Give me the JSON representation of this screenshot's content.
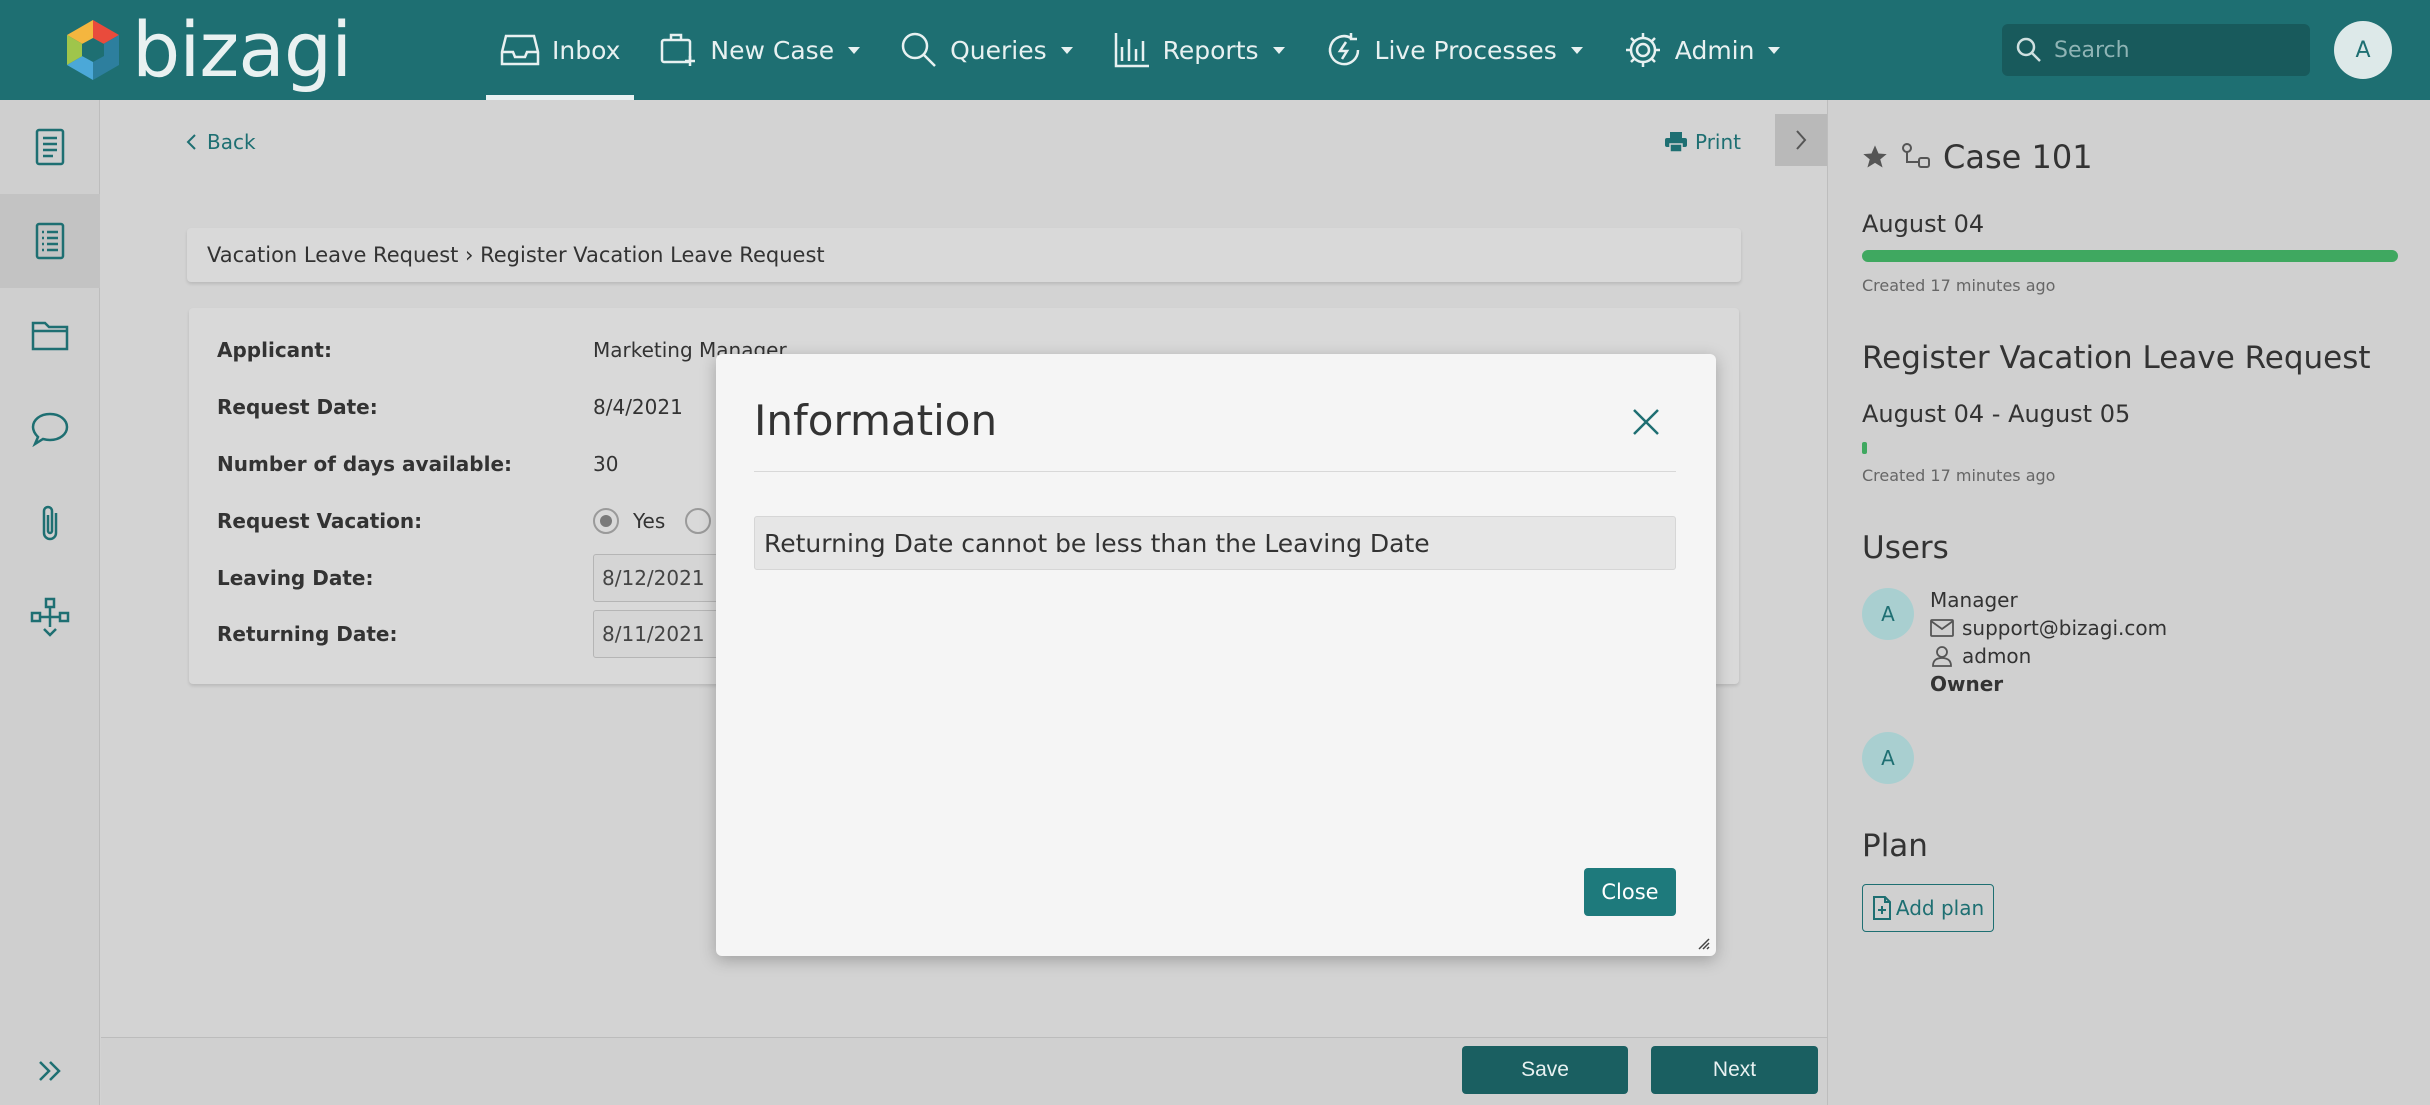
{
  "brand": {
    "name": "bizagi",
    "primary_color": "#1e6f72"
  },
  "nav": {
    "items": [
      {
        "label": "Inbox",
        "icon": "inbox-icon",
        "active": true
      },
      {
        "label": "New Case",
        "icon": "briefcase-plus-icon"
      },
      {
        "label": "Queries",
        "icon": "search-icon"
      },
      {
        "label": "Reports",
        "icon": "chart-icon"
      },
      {
        "label": "Live Processes",
        "icon": "live-process-icon"
      },
      {
        "label": "Admin",
        "icon": "gear-icon"
      }
    ],
    "search_placeholder": "Search",
    "avatar_initial": "A"
  },
  "sidebar": {
    "items": [
      "form-icon",
      "form-list-icon",
      "folder-icon",
      "chat-icon",
      "attachment-icon",
      "process-map-icon"
    ],
    "expand_icon": "double-chevron-right-icon"
  },
  "main": {
    "back_label": "Back",
    "print_label": "Print",
    "breadcrumb": "Vacation Leave Request › Register Vacation Leave Request",
    "form": {
      "applicant_label": "Applicant:",
      "applicant_value": "Marketing Manager",
      "request_date_label": "Request Date:",
      "request_date_value": "8/4/2021",
      "days_label": "Number of days available:",
      "days_value": "30",
      "request_vacation_label": "Request Vacation:",
      "request_vacation_yes": "Yes",
      "leaving_date_label": "Leaving Date:",
      "leaving_date_value": "8/12/2021",
      "returning_date_label": "Returning Date:",
      "returning_date_value": "8/11/2021"
    }
  },
  "footer": {
    "save_label": "Save",
    "next_label": "Next"
  },
  "right_panel": {
    "case_title": "Case 101",
    "case_date": "August 04",
    "case_progress": 1.0,
    "case_created": "Created 17 minutes ago",
    "task_title": "Register Vacation Leave Request",
    "task_range": "August 04 - August 05",
    "task_progress": 0.01,
    "task_created": "Created 17 minutes ago",
    "users_heading": "Users",
    "user1": {
      "initial": "A",
      "role": "Manager",
      "email": "support@bizagi.com",
      "username": "admon",
      "tag": "Owner"
    },
    "user2": {
      "initial": "A"
    },
    "plan_heading": "Plan",
    "add_plan_label": "Add plan"
  },
  "modal": {
    "title": "Information",
    "message": "Returning Date cannot be less than the Leaving Date",
    "close_label": "Close"
  }
}
